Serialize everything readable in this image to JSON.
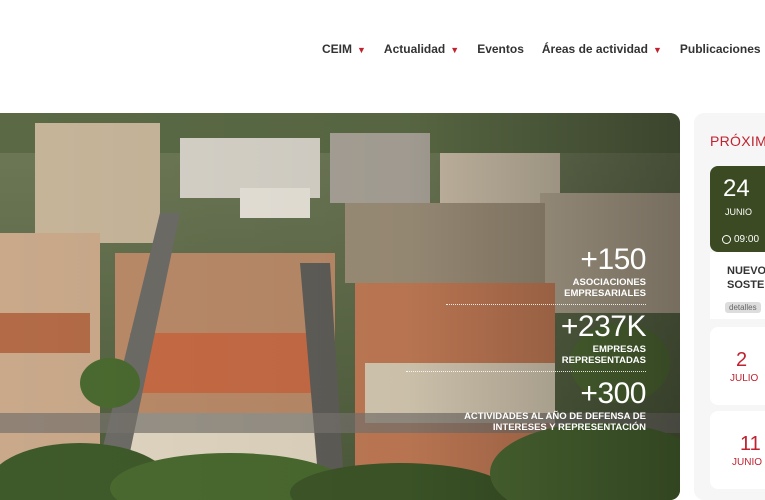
{
  "nav": {
    "items": [
      {
        "label": "CEIM",
        "dropdown": true
      },
      {
        "label": "Actualidad",
        "dropdown": true
      },
      {
        "label": "Eventos",
        "dropdown": false
      },
      {
        "label": "Áreas de actividad",
        "dropdown": true
      },
      {
        "label": "Publicaciones",
        "dropdown": false
      }
    ]
  },
  "hero": {
    "stats": [
      {
        "number": "+150",
        "label": "ASOCIACIONES EMPRESARIALES"
      },
      {
        "number": "+237K",
        "label": "EMPRESAS REPRESENTADAS"
      },
      {
        "number": "+300",
        "label": "ACTIVIDADES AL AÑO DE DEFENSA DE INTERESES Y REPRESENTACIÓN"
      }
    ]
  },
  "side": {
    "title": "PRÓXIM",
    "featured": {
      "day": "24",
      "month": "JUNIO",
      "time": "09:00",
      "title": "NUEVO SOSTE",
      "tag": "detalles"
    },
    "dates": [
      {
        "day": "2",
        "month": "JULIO"
      },
      {
        "day": "11",
        "month": "JUNIO"
      }
    ]
  },
  "colors": {
    "accent": "#c0222f",
    "event_green": "#3b4a22"
  }
}
